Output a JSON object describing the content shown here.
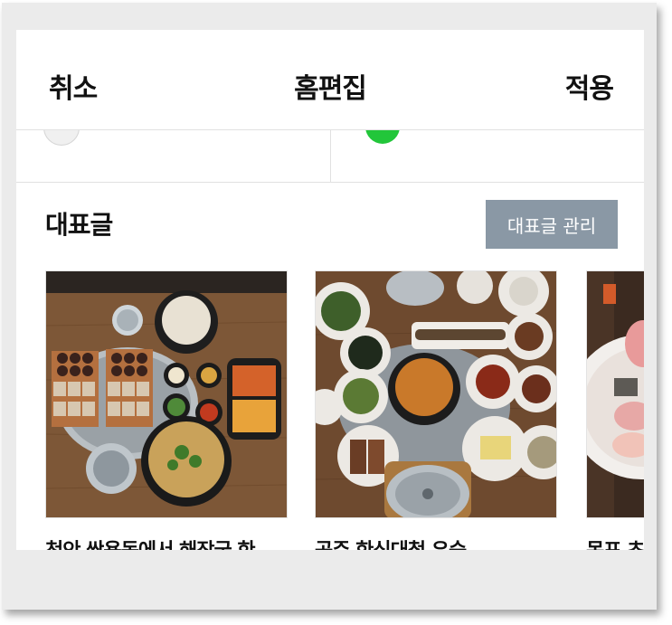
{
  "header": {
    "cancel_label": "취소",
    "title": "홈편집",
    "apply_label": "적용"
  },
  "previous_row": {
    "left_label": "",
    "right_label": ""
  },
  "featured": {
    "title": "대표글",
    "manage_label": "대표글 관리",
    "posts": [
      {
        "caption": "천안 쌍용동에서 해장국 한"
      },
      {
        "caption": "공주 한식대첩 우승"
      },
      {
        "caption": "목포 초"
      }
    ]
  },
  "colors": {
    "manage_button_bg": "#8a98a5",
    "green_icon": "#22c63a"
  }
}
